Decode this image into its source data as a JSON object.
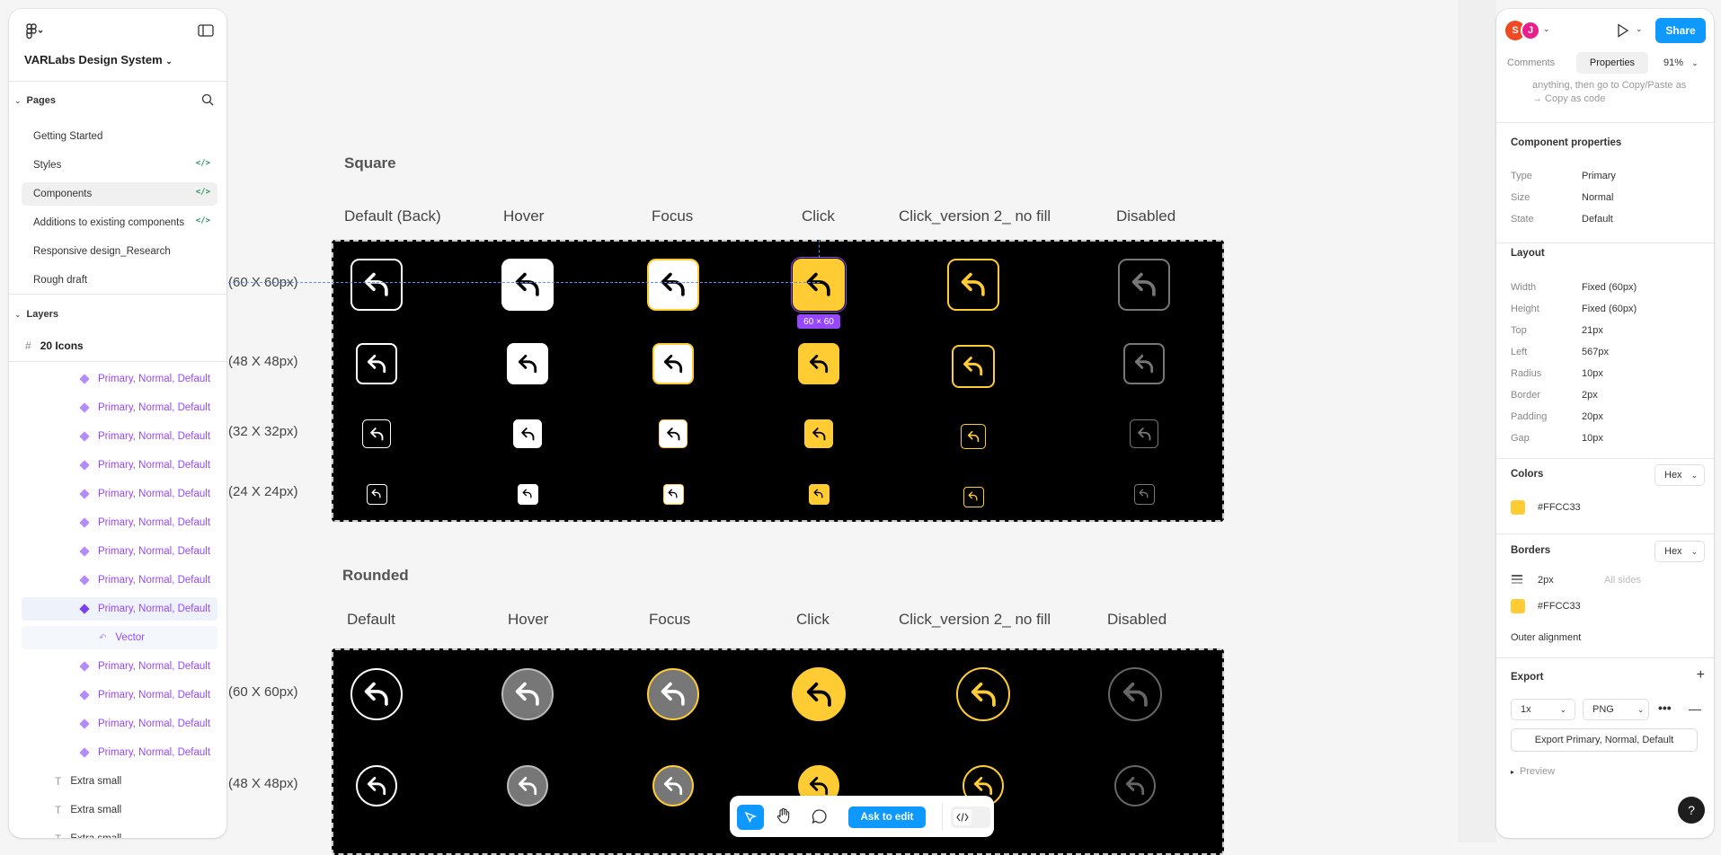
{
  "app": {
    "file_name": "VARLabs Design System"
  },
  "left": {
    "pages_header": "Pages",
    "pages": [
      {
        "label": "Getting Started",
        "code": false,
        "selected": false
      },
      {
        "label": "Styles",
        "code": true,
        "selected": false
      },
      {
        "label": "Components",
        "code": true,
        "selected": true
      },
      {
        "label": "Additions to existing components",
        "code": true,
        "selected": false
      },
      {
        "label": "Responsive design_Research",
        "code": false,
        "selected": false
      },
      {
        "label": "Rough draft",
        "code": false,
        "selected": false
      }
    ],
    "code_glyph": "</>",
    "layers_header": "Layers",
    "frame_name": "20 Icons",
    "layers": [
      "Primary, Normal, Default",
      "Primary, Normal, Default",
      "Primary, Normal, Default",
      "Primary, Normal, Default",
      "Primary, Normal, Default",
      "Primary, Normal, Default",
      "Primary, Normal, Default",
      "Primary, Normal, Default",
      "Primary, Normal, Default",
      "Vector",
      "Primary, Normal, Default",
      "Primary, Normal, Default",
      "Primary, Normal, Default",
      "Primary, Normal, Default",
      "Extra small",
      "Extra small",
      "Extra small"
    ]
  },
  "canvas": {
    "square_title": "Square",
    "rounded_title": "Rounded",
    "square_cols": [
      "Default (Back)",
      "Hover",
      "Focus",
      "Click",
      "Click_version 2_ no fill",
      "Disabled"
    ],
    "rounded_cols": [
      "Default",
      "Hover",
      "Focus",
      "Click",
      "Click_version 2_ no fill",
      "Disabled"
    ],
    "square_rows": [
      "(60 X 60px)",
      "(48 X 48px)",
      "(32 X 32px)",
      "(24 X 24px)"
    ],
    "rounded_rows": [
      "(60 X 60px)",
      "(48 X 48px)"
    ],
    "size_badge": "60 × 60",
    "accent": "#FFCC33"
  },
  "toolbar": {
    "ask_to_edit": "Ask to edit"
  },
  "right": {
    "avatars": [
      "S",
      "J"
    ],
    "share_label": "Share",
    "tab_comments": "Comments",
    "tab_properties": "Properties",
    "zoom": "91%",
    "hint_text": "anything, then go to Copy/Paste as → Copy as code",
    "component_properties_title": "Component properties",
    "component_properties": [
      {
        "k": "Type",
        "v": "Primary"
      },
      {
        "k": "Size",
        "v": "Normal"
      },
      {
        "k": "State",
        "v": "Default"
      }
    ],
    "layout_title": "Layout",
    "layout": [
      {
        "k": "Width",
        "v": "Fixed (60px)"
      },
      {
        "k": "Height",
        "v": "Fixed (60px)"
      },
      {
        "k": "Top",
        "v": "21px"
      },
      {
        "k": "Left",
        "v": "567px"
      },
      {
        "k": "Radius",
        "v": "10px"
      },
      {
        "k": "Border",
        "v": "2px"
      },
      {
        "k": "Padding",
        "v": "20px"
      },
      {
        "k": "Gap",
        "v": "10px"
      }
    ],
    "colors_title": "Colors",
    "hex_label": "Hex",
    "color_value": "#FFCC33",
    "borders_title": "Borders",
    "border_width": "2px",
    "border_sides": "All sides",
    "border_color": "#FFCC33",
    "outer_alignment": "Outer alignment",
    "export_title": "Export",
    "export_scale": "1x",
    "export_format": "PNG",
    "export_button": "Export Primary, Normal, Default",
    "preview_label": "Preview",
    "help": "?"
  }
}
